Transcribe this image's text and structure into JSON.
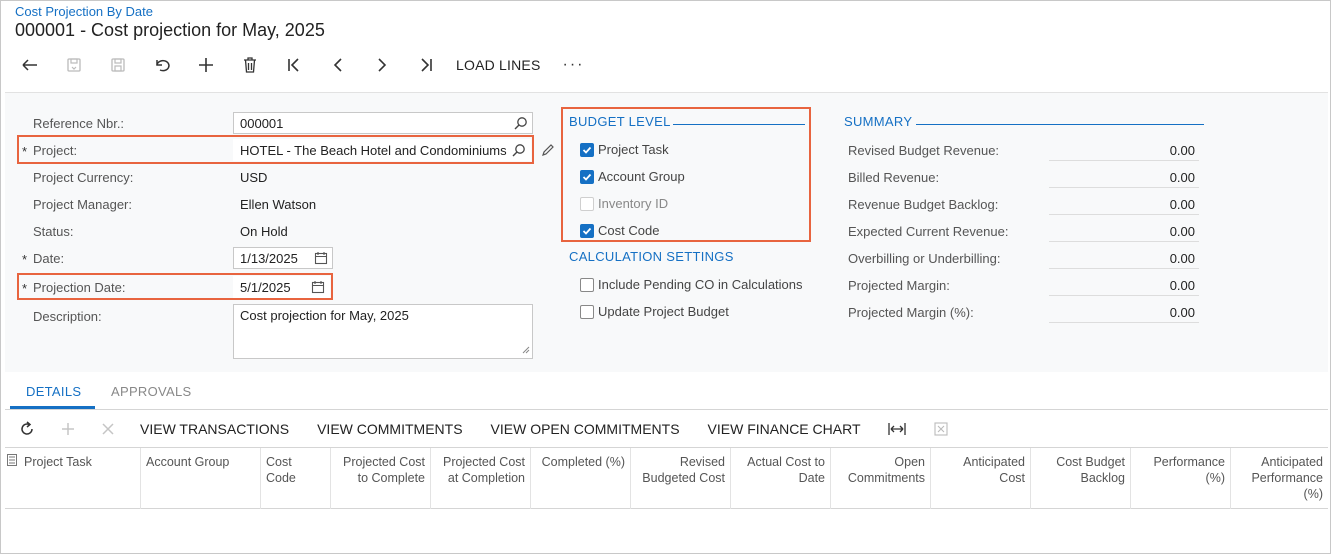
{
  "header": {
    "breadcrumb": "Cost Projection By Date",
    "title": "000001 - Cost projection for May, 2025"
  },
  "toolbar": {
    "load_lines": "LOAD LINES",
    "more": "···"
  },
  "form": {
    "reference_nbr": {
      "label": "Reference Nbr.:",
      "value": "000001"
    },
    "project": {
      "label": "Project:",
      "value": "HOTEL - The Beach Hotel and Condominiums",
      "required": "*"
    },
    "project_currency": {
      "label": "Project Currency:",
      "value": "USD"
    },
    "project_manager": {
      "label": "Project Manager:",
      "value": "Ellen Watson"
    },
    "status": {
      "label": "Status:",
      "value": "On Hold"
    },
    "date": {
      "label": "Date:",
      "value": "1/13/2025",
      "required": "*"
    },
    "projection_date": {
      "label": "Projection Date:",
      "value": "5/1/2025",
      "required": "*"
    },
    "description": {
      "label": "Description:",
      "value": "Cost projection for May, 2025"
    }
  },
  "budget_level": {
    "title": "BUDGET LEVEL",
    "items": [
      {
        "label": "Project Task",
        "checked": true
      },
      {
        "label": "Account Group",
        "checked": true
      },
      {
        "label": "Inventory ID",
        "checked": false,
        "disabled": true
      },
      {
        "label": "Cost Code",
        "checked": true
      }
    ]
  },
  "calc_settings": {
    "title": "CALCULATION SETTINGS",
    "items": [
      {
        "label": "Include Pending CO in Calculations",
        "checked": false
      },
      {
        "label": "Update Project Budget",
        "checked": false
      }
    ]
  },
  "summary": {
    "title": "SUMMARY",
    "rows": [
      {
        "label": "Revised Budget Revenue:",
        "value": "0.00"
      },
      {
        "label": "Billed Revenue:",
        "value": "0.00"
      },
      {
        "label": "Revenue Budget Backlog:",
        "value": "0.00"
      },
      {
        "label": "Expected Current Revenue:",
        "value": "0.00"
      },
      {
        "label": "Overbilling or Underbilling:",
        "value": "0.00"
      },
      {
        "label": "Projected Margin:",
        "value": "0.00"
      },
      {
        "label": "Projected Margin (%):",
        "value": "0.00"
      }
    ]
  },
  "tabs": [
    {
      "label": "DETAILS",
      "active": true
    },
    {
      "label": "APPROVALS",
      "active": false
    }
  ],
  "grid_toolbar": {
    "view_transactions": "VIEW TRANSACTIONS",
    "view_commitments": "VIEW COMMITMENTS",
    "view_open_commitments": "VIEW OPEN COMMITMENTS",
    "view_finance_chart": "VIEW FINANCE CHART"
  },
  "grid_columns": [
    {
      "label": "Project Task"
    },
    {
      "label": "Account Group"
    },
    {
      "label": "Cost Code"
    },
    {
      "label": "Projected Cost to Complete"
    },
    {
      "label": "Projected Cost at Completion"
    },
    {
      "label": "Completed (%)"
    },
    {
      "label": "Revised Budgeted Cost"
    },
    {
      "label": "Actual Cost to Date"
    },
    {
      "label": "Open Commitments"
    },
    {
      "label": "Anticipated Cost"
    },
    {
      "label": "Cost Budget Backlog"
    },
    {
      "label": "Performance (%)"
    },
    {
      "label": "Anticipated Performance (%)"
    }
  ],
  "colors": {
    "accent": "#1570c4",
    "highlight": "#e8643f"
  }
}
